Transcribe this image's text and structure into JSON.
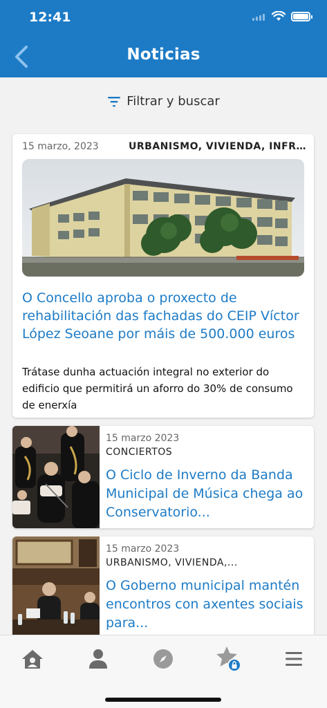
{
  "status_bar": {
    "time": "12:41"
  },
  "header": {
    "title": "Noticias",
    "back_icon": "chevron-left-icon",
    "color": "#1d7bc6"
  },
  "filter": {
    "label": "Filtrar y buscar",
    "icon": "filter-icon"
  },
  "featured": {
    "date": "15 marzo, 2023",
    "category": "URBANISMO, VIVIENDA, INFRA...",
    "title": "O Concello aproba o proxecto de rehabilitación das fachadas do CEIP Víctor López Seoane por máis de 500.000 euros",
    "summary": "Trátase dunha actuación integral no exterior do edificio que permitirá un aforro do 30% de consumo de enerxía"
  },
  "news": [
    {
      "date": "15 marzo 2023",
      "category": "CONCIERTOS",
      "title": "O Ciclo de Inverno da Banda Municipal de Música chega ao Conservatorio..."
    },
    {
      "date": "15 marzo 2023",
      "category": "URBANISMO, VIVIENDA,...",
      "title": "O Goberno municipal mantén encontros con axentes sociais para..."
    }
  ],
  "tabbar": {
    "items": [
      "home-icon",
      "user-icon",
      "compass-icon",
      "favorites-locked-icon",
      "menu-icon"
    ]
  }
}
